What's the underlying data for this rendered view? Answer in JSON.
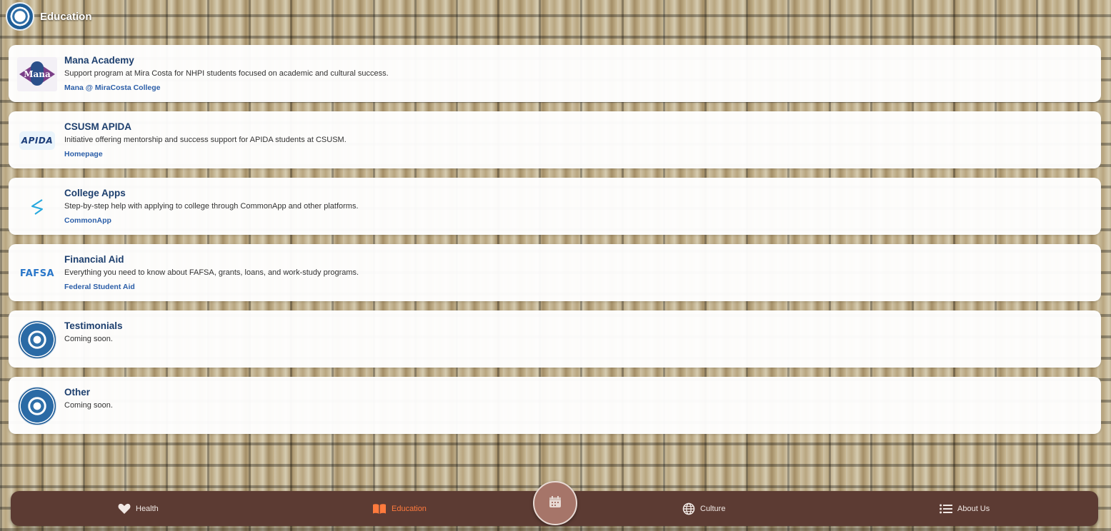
{
  "header": {
    "title": "Education",
    "logo_icon": "pacific-islander-community-seal-icon"
  },
  "cards": [
    {
      "title": "Mana Academy",
      "description": "Support program at Mira Costa for NHPI students focused on academic and cultural success.",
      "link": "Mana @ MiraCosta College",
      "logo_text": "Mana"
    },
    {
      "title": "CSUSM APIDA",
      "description": "Initiative offering mentorship and success support for APIDA students at CSUSM.",
      "link": "Homepage",
      "logo_text": "APIDA"
    },
    {
      "title": "College Apps",
      "description": "Step-by-step help with applying to college through CommonApp and other platforms.",
      "link": "CommonApp"
    },
    {
      "title": "Financial Aid",
      "description": "Everything you need to know about FAFSA, grants, loans, and work-study programs.",
      "link": "Federal Student Aid",
      "logo_text": "FAFSA"
    },
    {
      "title": "Testimonials",
      "description": "Coming soon."
    },
    {
      "title": "Other",
      "description": "Coming soon."
    }
  ],
  "nav": {
    "health": "Health",
    "education": "Education",
    "culture": "Culture",
    "about": "About Us",
    "center_icon": "calendar-icon",
    "active": "education",
    "active_color": "#ff7a3d",
    "bar_color": "#5c3b33"
  }
}
